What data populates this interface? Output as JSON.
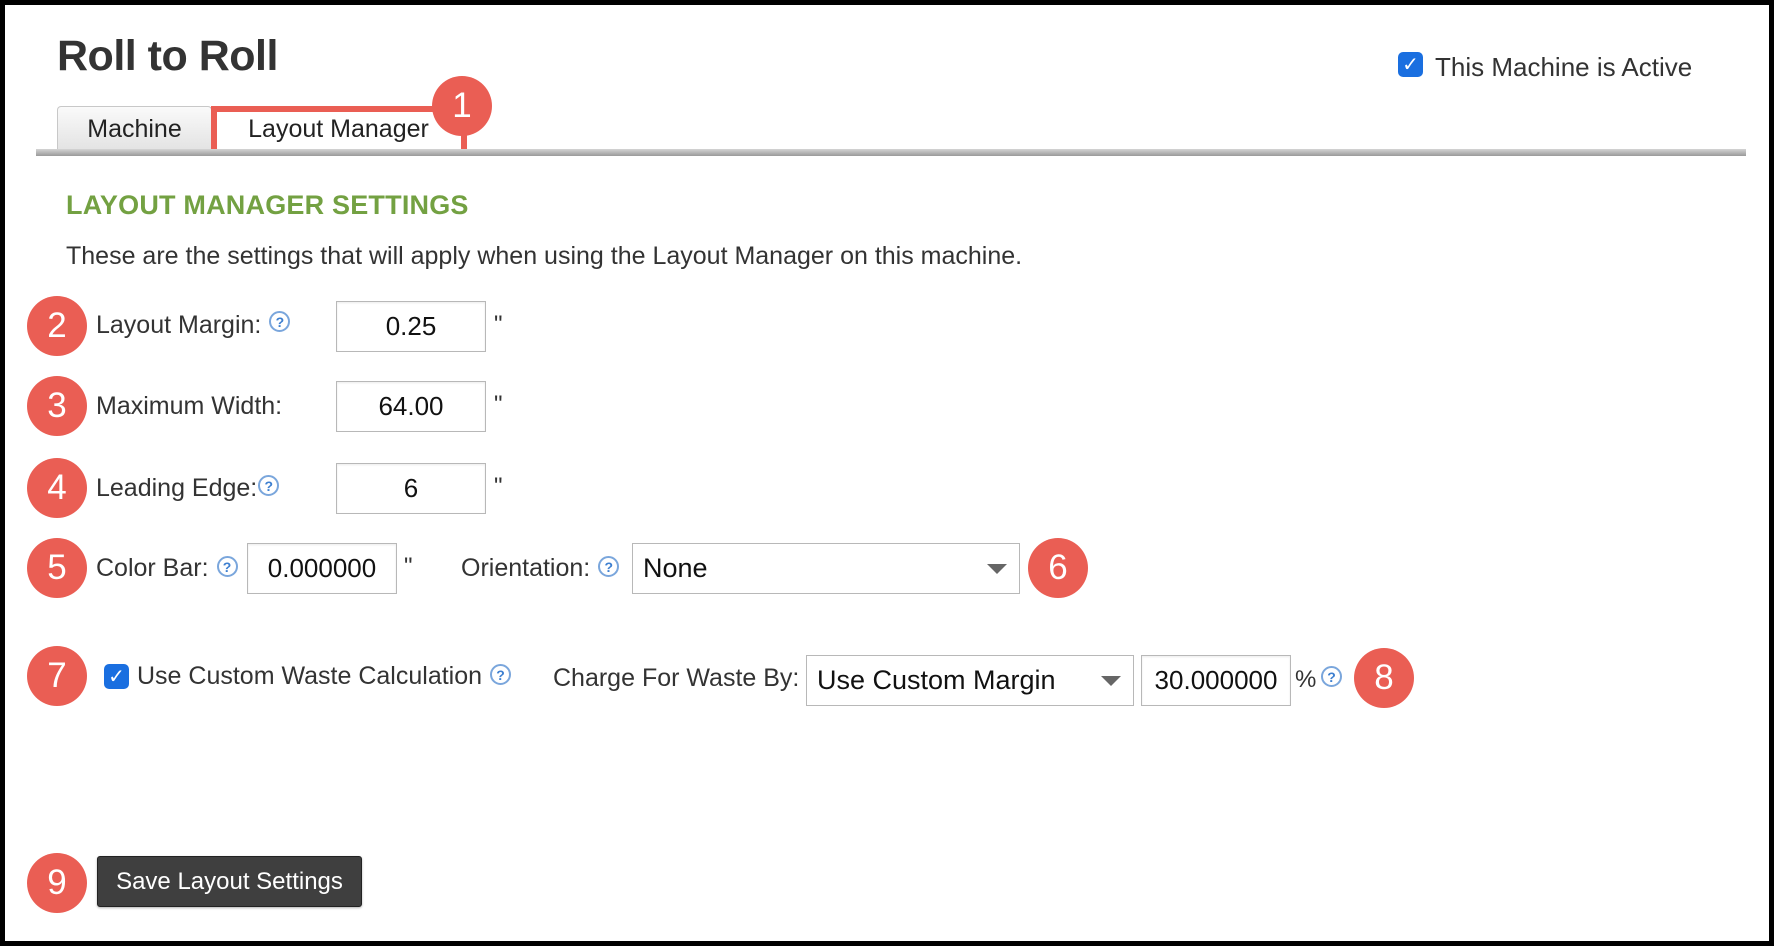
{
  "page": {
    "title": "Roll to Roll",
    "active_label": "This Machine is Active",
    "active_checked": true
  },
  "tabs": [
    {
      "label": "Machine",
      "selected": false
    },
    {
      "label": "Layout Manager",
      "selected": true
    }
  ],
  "callouts": [
    "1",
    "2",
    "3",
    "4",
    "5",
    "6",
    "7",
    "8",
    "9"
  ],
  "section": {
    "title": "LAYOUT MANAGER SETTINGS",
    "description": "These are the settings that will apply when using the Layout Manager on this machine."
  },
  "fields": {
    "layout_margin": {
      "label": "Layout Margin:",
      "value": "0.25",
      "unit": "\""
    },
    "maximum_width": {
      "label": "Maximum Width:",
      "value": "64.00",
      "unit": "\""
    },
    "leading_edge": {
      "label": "Leading Edge:",
      "value": "6",
      "unit": "\""
    },
    "color_bar": {
      "label": "Color Bar:",
      "value": "0.000000",
      "unit": "\""
    },
    "orientation": {
      "label": "Orientation:",
      "selected": "None"
    },
    "custom_waste": {
      "label": "Use Custom Waste Calculation",
      "checked": true
    },
    "charge_for_waste": {
      "label": "Charge For Waste By:",
      "selected": "Use Custom Margin",
      "value": "30.000000",
      "unit": "%"
    }
  },
  "help_icon_glyph": "?",
  "checkbox_glyph": "✓",
  "save_button_label": "Save Layout Settings",
  "colors": {
    "accent_badge": "#ea5e54",
    "section_title": "#73a142",
    "checkbox": "#1a6fe0",
    "save_button": "#3f3f3f"
  }
}
